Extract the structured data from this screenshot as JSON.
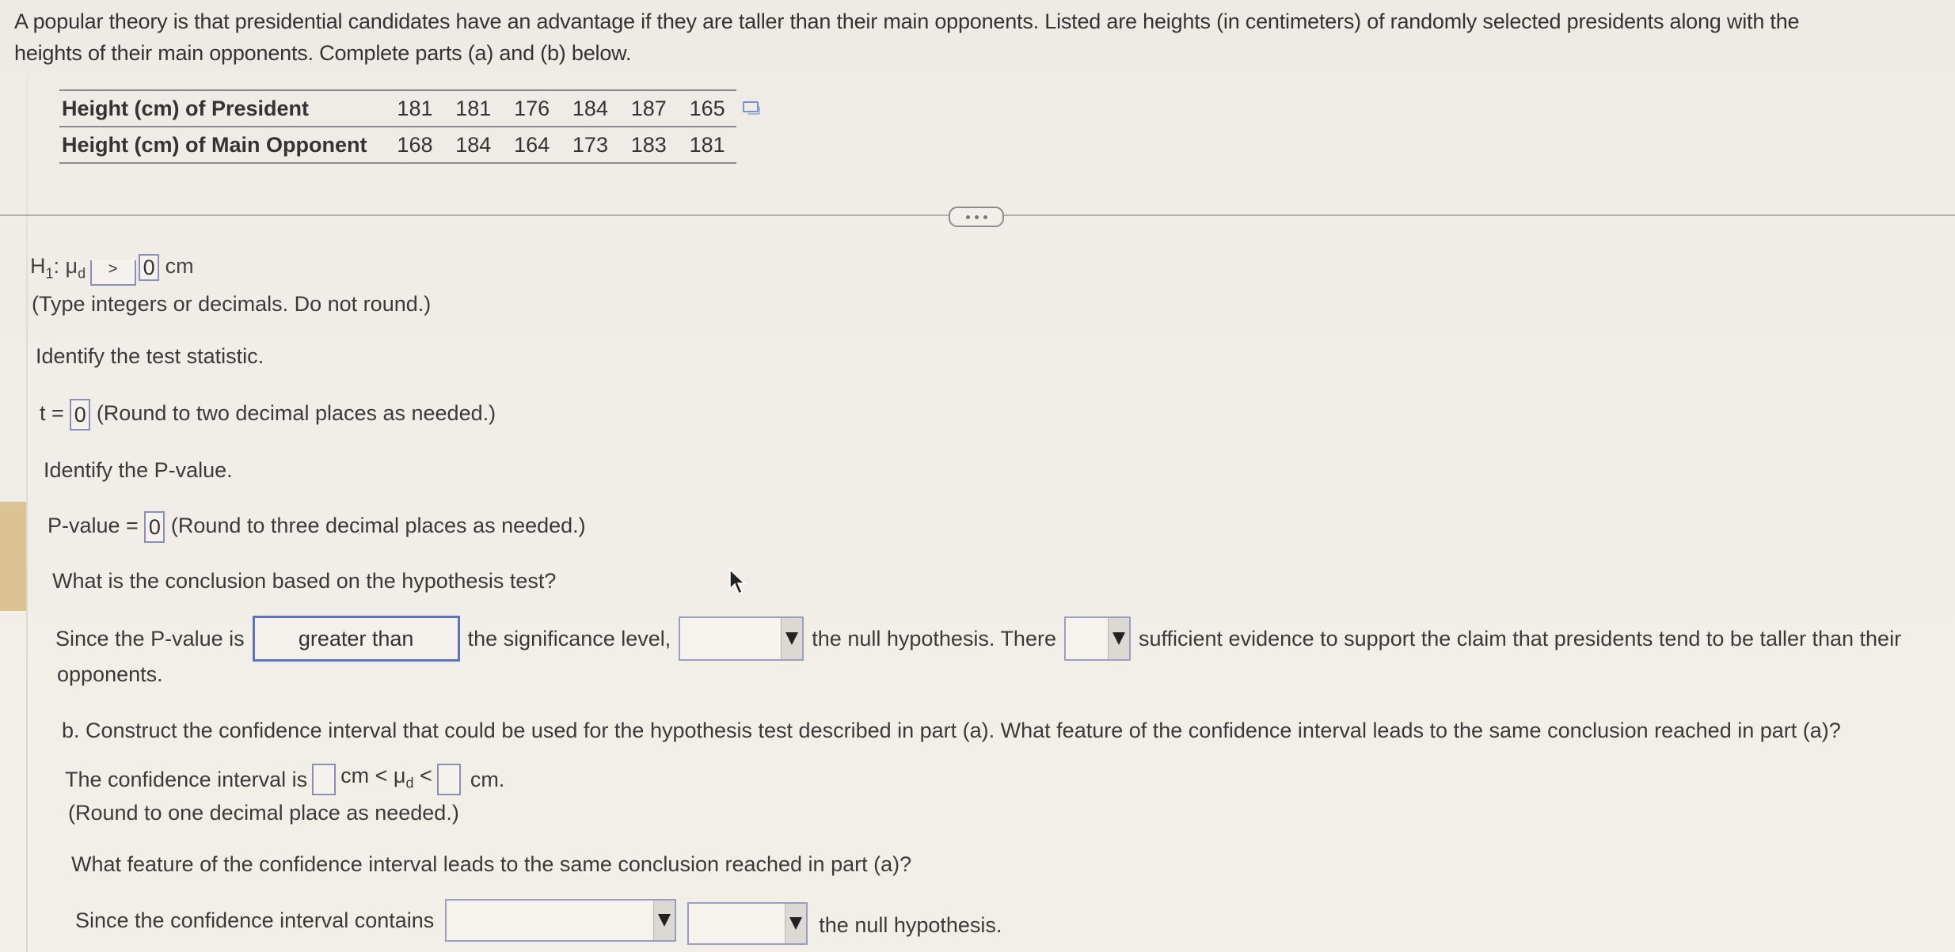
{
  "intro": {
    "line1": "A popular theory is that presidential candidates have an advantage if they are taller than their main opponents. Listed are heights (in centimeters) of randomly selected presidents along with the",
    "line2": "heights of their main opponents. Complete parts (a) and (b) below."
  },
  "table": {
    "rows": [
      {
        "label": "Height (cm) of President",
        "values": [
          "181",
          "181",
          "176",
          "184",
          "187",
          "165"
        ]
      },
      {
        "label": "Height (cm) of Main Opponent",
        "values": [
          "168",
          "184",
          "164",
          "173",
          "183",
          "181"
        ]
      }
    ],
    "copy_icon": "copy-table-icon"
  },
  "divider": {
    "more_label": "..."
  },
  "part_a": {
    "h1_prefix": "H",
    "h1_sub": "1",
    "h1_colon": ": μ",
    "h1_mu_sub": "d",
    "h1_operator": ">",
    "h1_value": "0",
    "h1_unit": "cm",
    "h1_hint": "(Type integers or decimals. Do not round.)",
    "test_stat_prompt": "Identify the test statistic.",
    "t_label": "t =",
    "t_value": "0",
    "t_hint": "(Round to two decimal places as needed.)",
    "pvalue_prompt": "Identify the P-value.",
    "pvalue_label": "P-value =",
    "pvalue_value": "0",
    "pvalue_hint": "(Round to three decimal places as needed.)",
    "conclusion_prompt": "What is the conclusion based on the hypothesis test?",
    "conclusion": {
      "text1": "Since the P-value is",
      "comparison_value": "greater than",
      "text2": "the significance level,",
      "decision_value": "",
      "text3": "the null hypothesis. There",
      "evidence_value": "",
      "text4": "sufficient evidence to support the claim that presidents tend to be taller than their",
      "text5": "opponents."
    }
  },
  "part_b": {
    "prompt": "b. Construct the confidence interval that could be used for the hypothesis test described in part (a). What feature of the confidence interval leads to the same conclusion reached in part (a)?",
    "ci_text1": "The confidence interval is",
    "ci_lower": "",
    "ci_mid": "cm < μ",
    "ci_mid_sub": "d",
    "ci_lt": "<",
    "ci_upper": "",
    "ci_end": "cm.",
    "ci_hint": "(Round to one decimal place as needed.)",
    "feature_prompt": "What feature of the confidence interval leads to the same conclusion reached in part (a)?",
    "feature_text1": "Since the confidence interval contains",
    "feature_select1": "",
    "feature_select2": "",
    "feature_text2": "the null hypothesis."
  },
  "colors": {
    "accent_border": "#5e73b8",
    "input_border": "#8c8fb5",
    "left_strip": "#dcc394"
  }
}
